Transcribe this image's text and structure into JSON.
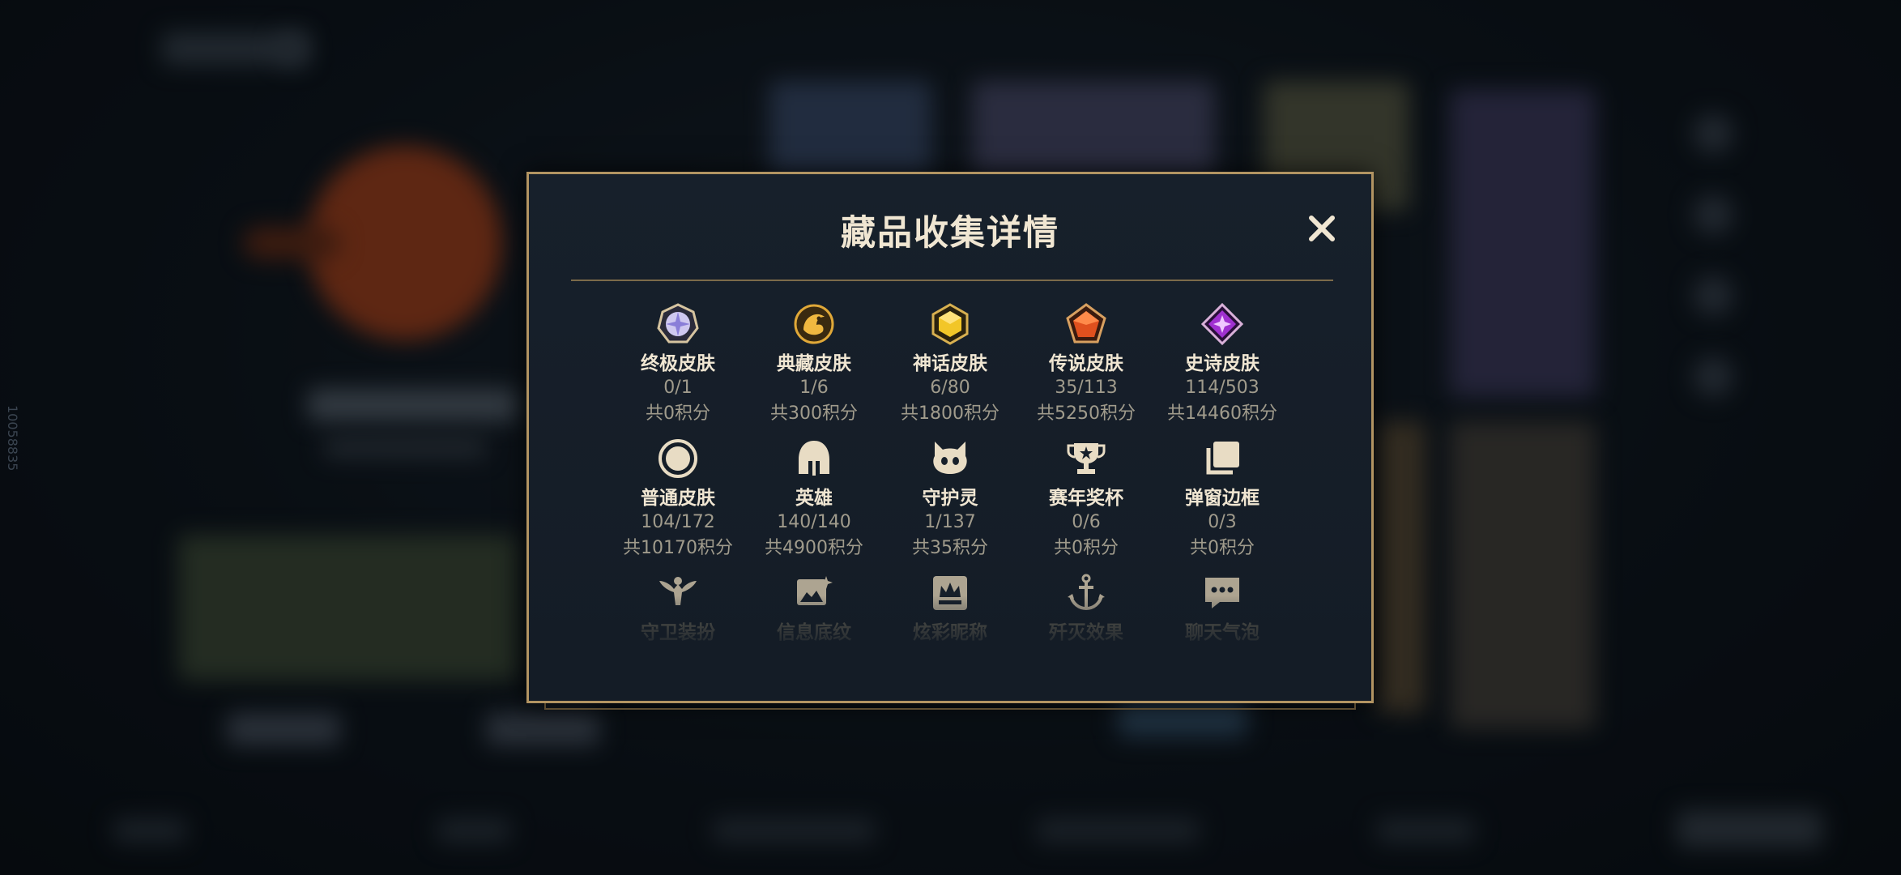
{
  "modal": {
    "title": "藏品收集详情"
  },
  "side_id": "10058835",
  "colors": {
    "accent_gold": "#b29462",
    "title_text": "#f0e6d2",
    "sub_text": "#a09b8c",
    "modal_bg": "#17202b"
  },
  "row1": [
    {
      "name": "终极皮肤",
      "count": "0/1",
      "points": "共0积分",
      "icon": "ultimate-skin-icon"
    },
    {
      "name": "典藏皮肤",
      "count": "1/6",
      "points": "共300积分",
      "icon": "prestige-skin-icon"
    },
    {
      "name": "神话皮肤",
      "count": "6/80",
      "points": "共1800积分",
      "icon": "mythic-skin-icon"
    },
    {
      "name": "传说皮肤",
      "count": "35/113",
      "points": "共5250积分",
      "icon": "legendary-skin-icon"
    },
    {
      "name": "史诗皮肤",
      "count": "114/503",
      "points": "共14460积分",
      "icon": "epic-skin-icon"
    }
  ],
  "row2": [
    {
      "name": "普通皮肤",
      "count": "104/172",
      "points": "共10170积分",
      "icon": "standard-skin-icon"
    },
    {
      "name": "英雄",
      "count": "140/140",
      "points": "共4900积分",
      "icon": "champion-helmet-icon"
    },
    {
      "name": "守护灵",
      "count": "1/137",
      "points": "共35积分",
      "icon": "little-legend-icon"
    },
    {
      "name": "赛年奖杯",
      "count": "0/6",
      "points": "共0积分",
      "icon": "trophy-icon"
    },
    {
      "name": "弹窗边框",
      "count": "0/3",
      "points": "共0积分",
      "icon": "border-frame-icon"
    }
  ],
  "row3": [
    {
      "name": "守卫装扮",
      "icon": "ward-skin-icon"
    },
    {
      "name": "信息底纹",
      "icon": "banner-icon"
    },
    {
      "name": "炫彩昵称",
      "icon": "nameplate-icon"
    },
    {
      "name": "歼灭效果",
      "icon": "finisher-icon"
    },
    {
      "name": "聊天气泡",
      "icon": "chat-bubble-icon"
    }
  ]
}
